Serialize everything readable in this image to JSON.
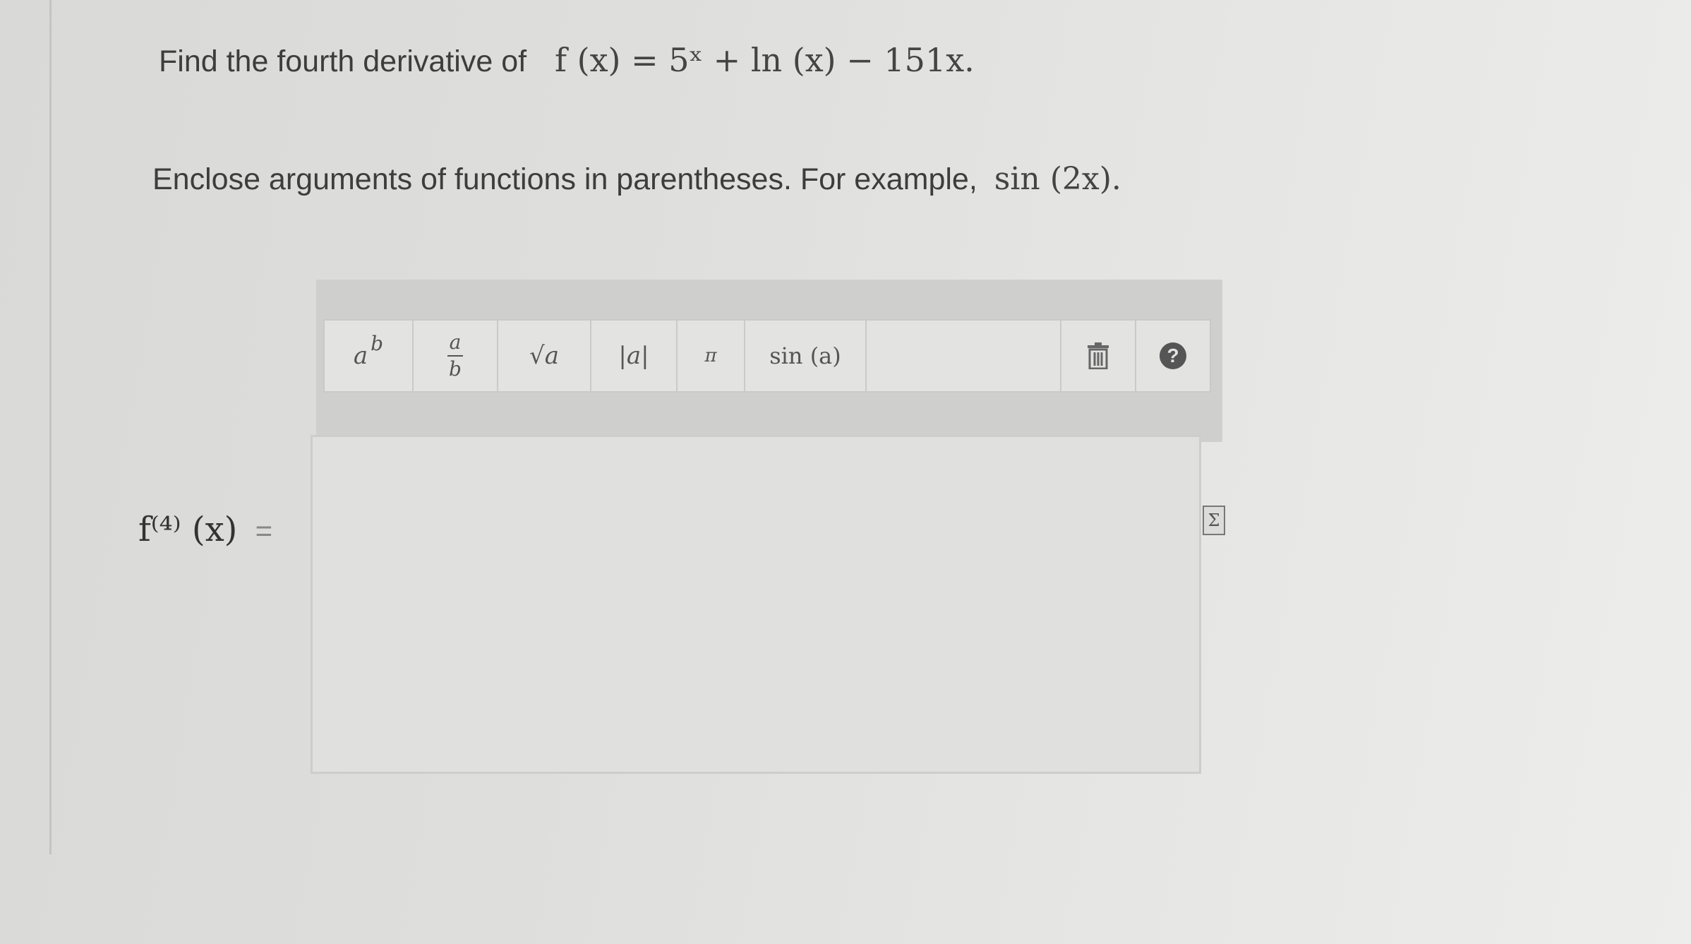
{
  "question": {
    "text": "Find the fourth derivative of",
    "function": "f (x) = 5ˣ + ln (x) − 151x."
  },
  "instruction": {
    "text": "Enclose arguments of functions in parentheses. For example,",
    "example": "sin (2x)."
  },
  "answer": {
    "label": "f⁽⁴⁾ (x)",
    "equals": "=",
    "value": ""
  },
  "toolbar": {
    "power_base": "a",
    "power_exp": "b",
    "fraction_num": "a",
    "fraction_den": "b",
    "sqrt_label": "√a",
    "abs_label": "|a|",
    "pi_label": "π",
    "sin_label": "sin (a)",
    "help_label": "?"
  },
  "icons": {
    "trash": "trash-icon",
    "help": "help-icon",
    "equation_editor": "sigma-icon"
  }
}
